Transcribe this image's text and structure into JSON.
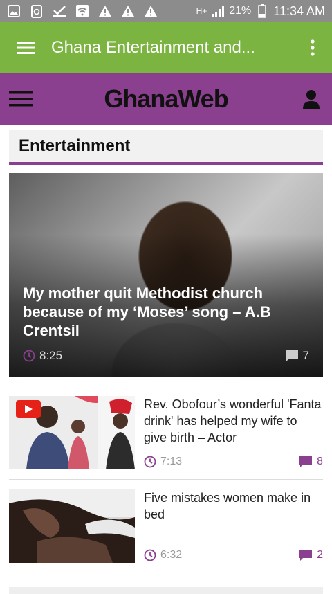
{
  "status_bar": {
    "network": "H+",
    "battery": "21%",
    "time": "11:34 AM",
    "icons": [
      "image-icon",
      "recycle-icon",
      "check-icon",
      "wifi-icon",
      "warning-icon",
      "warning-icon",
      "warning-icon",
      "signal-icon",
      "battery-icon"
    ]
  },
  "app_bar": {
    "title": "Ghana Entertainment and..."
  },
  "site_header": {
    "logo": "GhanaWeb"
  },
  "section": {
    "title": "Entertainment"
  },
  "hero": {
    "title": "My mother quit Methodist church because of my ‘Moses’ song – A.B Crentsil",
    "time": "8:25",
    "comments": "7"
  },
  "articles": [
    {
      "title": "Rev. Obofour’s wonderful 'Fanta drink' has helped my wife to give birth – Actor",
      "time": "7:13",
      "comments": "8"
    },
    {
      "title": "Five mistakes women make in bed",
      "time": "6:32",
      "comments": "2"
    }
  ],
  "colors": {
    "app_bar": "#7cb442",
    "brand_purple": "#8b3f8f",
    "status_bar": "#8c8c8c"
  }
}
